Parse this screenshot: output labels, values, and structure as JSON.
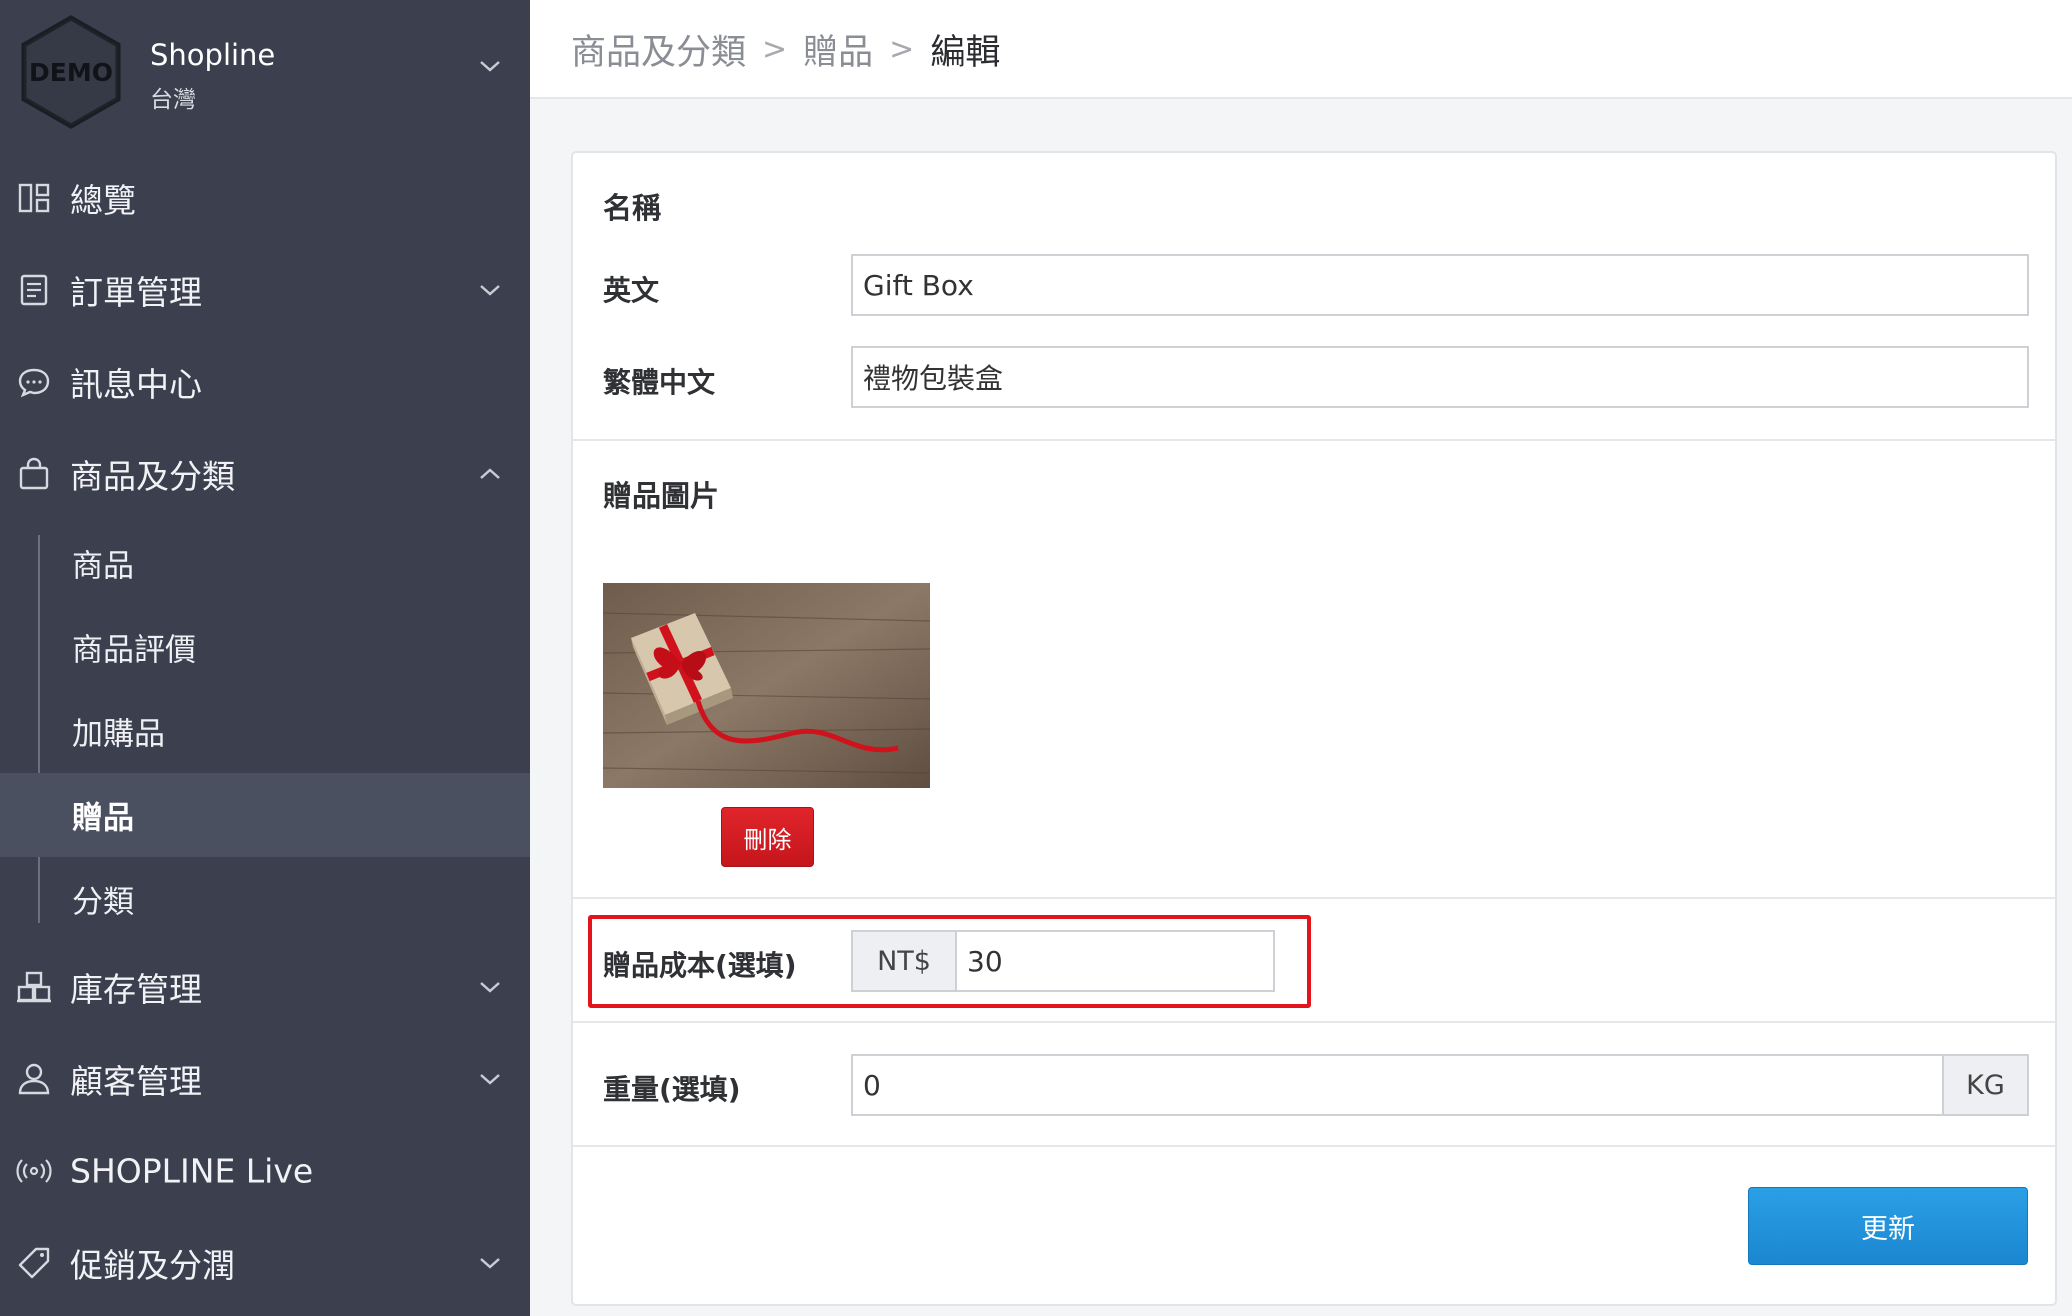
{
  "brand": {
    "logo_text": "DEMO",
    "name": "Shopline",
    "region": "台灣"
  },
  "nav": {
    "overview": "總覽",
    "orders": "訂單管理",
    "messages": "訊息中心",
    "products_categories": "商品及分類",
    "products_sub": [
      "商品",
      "商品評價",
      "加購品",
      "贈品",
      "分類"
    ],
    "inventory": "庫存管理",
    "customers": "顧客管理",
    "live": "SHOPLINE Live",
    "promotions": "促銷及分潤"
  },
  "breadcrumb": {
    "level1": "商品及分類",
    "level2": "贈品",
    "level3": "編輯",
    "separator": ">"
  },
  "form": {
    "name_section": "名稱",
    "english_label": "英文",
    "english_value": "Gift Box",
    "zh_label": "繁體中文",
    "zh_value": "禮物包裝盒",
    "image_section": "贈品圖片",
    "delete_label": "刪除",
    "cost_label": "贈品成本(選填)",
    "currency": "NT$",
    "cost_value": "30",
    "weight_label": "重量(選填)",
    "weight_value": "0",
    "weight_unit": "KG",
    "update_label": "更新"
  },
  "colors": {
    "sidebar": "#3b3f4e",
    "active_item": "#4b5061",
    "primary_button": "#1a87d0",
    "danger_button": "#d11f25",
    "highlight_border": "#e3141b"
  },
  "icons": {
    "overview": "dashboard-icon",
    "orders": "document-icon",
    "messages": "chat-icon",
    "products": "shopping-bag-icon",
    "inventory": "boxes-icon",
    "customers": "user-icon",
    "live": "broadcast-icon",
    "promotions": "tag-icon"
  }
}
